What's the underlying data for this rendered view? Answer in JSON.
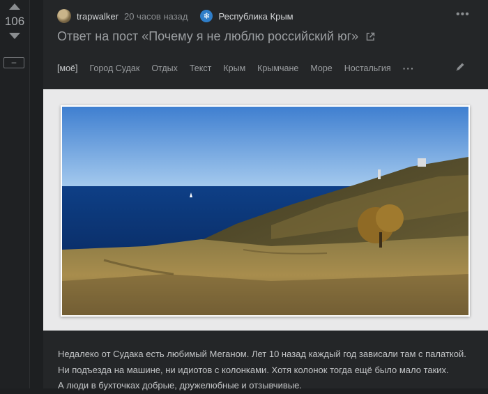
{
  "vote": {
    "count": "106",
    "minus_label": "–"
  },
  "post": {
    "author": "trapwalker",
    "time": "20 часов назад",
    "community": "Республика Крым",
    "title": "Ответ на пост «Почему я не люблю российский юг»",
    "tags": [
      "[моё]",
      "Город Судак",
      "Отдых",
      "Текст",
      "Крым",
      "Крымчане",
      "Море",
      "Ностальгия"
    ],
    "body": [
      "Недалеко от Судака есть любимый Меганом. Лет 10 назад каждый год зависали там с палаткой.",
      "Ни подъезда на машине, ни идиотов с колонками. Хотя колонок тогда ещё было мало таких.",
      "А люди в бухточках добрые, дружелюбные и отзывчивые."
    ]
  },
  "icons": {
    "vote_up": "arrow-up-icon",
    "vote_down": "arrow-down-icon",
    "community": "snowflake-icon",
    "external": "external-link-icon",
    "edit": "pencil-icon",
    "more": "ellipsis-icon"
  },
  "colors": {
    "background": "#1d1f21",
    "card": "#242628",
    "community_accent": "#2f7ec9",
    "text": "#c3c5c7"
  }
}
